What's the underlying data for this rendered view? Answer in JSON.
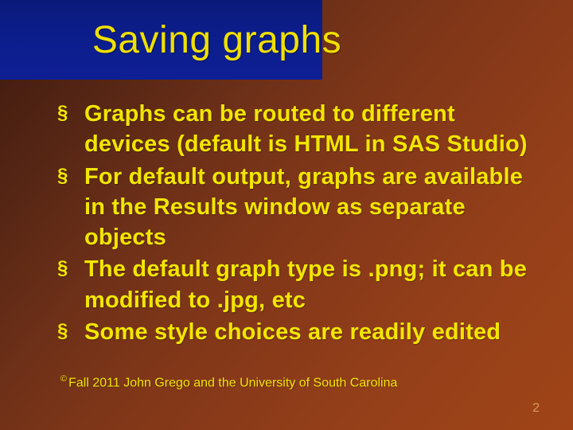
{
  "title": "Saving graphs",
  "bullets": [
    "Graphs can be routed to different devices (default is HTML in SAS Studio)",
    "For default output, graphs are available in the Results window as separate objects",
    "The default graph type is .png; it can be modified to .jpg, etc",
    "Some style choices are readily edited"
  ],
  "copyright_mark": "©",
  "copyright": "Fall 2011 John Grego and the University of South Carolina",
  "page_number": "2"
}
